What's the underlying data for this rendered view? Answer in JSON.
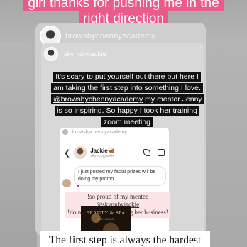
{
  "headline": "girl thanks for pushing me in the right direction",
  "outer_post": {
    "handle": "browsbychennyacademy"
  },
  "inner_post": {
    "handle": "skynnbyjackie"
  },
  "quote": {
    "part1": "It's scary to put yourself out there but here I am taking the first step into something I love. ",
    "mention": "@browsbychennyacademy",
    "part2": " my mentor  Jenny is so inspiring. So happy I took her training zoom meeting"
  },
  "dm": {
    "source_handle": "browsbychennyacademy",
    "contact_name": "Jackie",
    "contact_name_emoji": "🦋",
    "contact_username": "skynnbyjackie",
    "message": "I just posted my facial prizes will be doing my promo",
    "reaction": "♥",
    "reply_part1": "!so proud of my mentee ",
    "reply_mention": "@skynnbyjackie",
    "reply_part2": "!doing her hw & building her business!",
    "promo_title": "BEAUTY & SPA",
    "promo_subtitle": "BACK FACIAL"
  },
  "caption": "The first step is always the hardest",
  "colors": {
    "headline_bg": "#ea5b8a",
    "quote_bg": "#111111",
    "reply_bg": "#fbe3e6"
  }
}
